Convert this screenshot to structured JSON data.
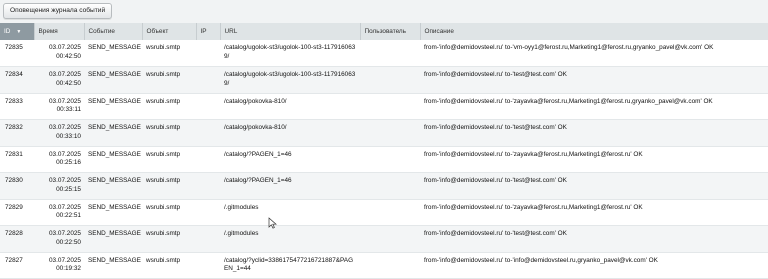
{
  "toolbar": {
    "notify_button": "Оповещения журнала событий"
  },
  "table": {
    "headers": {
      "id": "ID",
      "time": "Время",
      "event": "Событие",
      "object": "Объект",
      "ip": "IP",
      "url": "URL",
      "user": "Пользователь",
      "description": "Описание"
    },
    "sort_icon": "sort-desc-icon",
    "rows": [
      {
        "id": "72835",
        "date": "03.07.2025",
        "time": "00:42:50",
        "event": "SEND_MESSAGE",
        "object": "wsrubi.smtp",
        "ip": "",
        "url": "/catalog/ugolok-st3/ugolok-100-st3-1179160639/",
        "user": "",
        "desc": "from-'info@demidovsteel.ru' to-'vm-oyy1@ferost.ru,Marketing1@ferost.ru,gryanko_pavel@vk.com' OK"
      },
      {
        "id": "72834",
        "date": "03.07.2025",
        "time": "00:42:50",
        "event": "SEND_MESSAGE",
        "object": "wsrubi.smtp",
        "ip": "",
        "url": "/catalog/ugolok-st3/ugolok-100-st3-1179160639/",
        "user": "",
        "desc": "from-'info@demidovsteel.ru' to-'test@test.com' OK"
      },
      {
        "id": "72833",
        "date": "03.07.2025",
        "time": "00:33:11",
        "event": "SEND_MESSAGE",
        "object": "wsrubi.smtp",
        "ip": "",
        "url": "/catalog/pokovka-810/",
        "user": "",
        "desc": "from-'info@demidovsteel.ru' to-'zayavka@ferost.ru,Marketing1@ferost.ru,gryanko_pavel@vk.com' OK"
      },
      {
        "id": "72832",
        "date": "03.07.2025",
        "time": "00:33:10",
        "event": "SEND_MESSAGE",
        "object": "wsrubi.smtp",
        "ip": "",
        "url": "/catalog/pokovka-810/",
        "user": "",
        "desc": "from-'info@demidovsteel.ru' to-'test@test.com' OK"
      },
      {
        "id": "72831",
        "date": "03.07.2025",
        "time": "00:25:16",
        "event": "SEND_MESSAGE",
        "object": "wsrubi.smtp",
        "ip": "",
        "url": "/catalog/?PAGEN_1=46",
        "user": "",
        "desc": "from-'info@demidovsteel.ru' to-'zayavka@ferost.ru,Marketing1@ferost.ru' OK"
      },
      {
        "id": "72830",
        "date": "03.07.2025",
        "time": "00:25:15",
        "event": "SEND_MESSAGE",
        "object": "wsrubi.smtp",
        "ip": "",
        "url": "/catalog/?PAGEN_1=46",
        "user": "",
        "desc": "from-'info@demidovsteel.ru' to-'test@test.com' OK"
      },
      {
        "id": "72829",
        "date": "03.07.2025",
        "time": "00:22:51",
        "event": "SEND_MESSAGE",
        "object": "wsrubi.smtp",
        "ip": "",
        "url": "/.gitmodules",
        "user": "",
        "desc": "from-'info@demidovsteel.ru' to-'zayavka@ferost.ru,Marketing1@ferost.ru' OK"
      },
      {
        "id": "72828",
        "date": "03.07.2025",
        "time": "00:22:50",
        "event": "SEND_MESSAGE",
        "object": "wsrubi.smtp",
        "ip": "",
        "url": "/.gitmodules",
        "user": "",
        "desc": "from-'info@demidovsteel.ru' to-'test@test.com' OK"
      },
      {
        "id": "72827",
        "date": "03.07.2025",
        "time": "00:19:32",
        "event": "SEND_MESSAGE",
        "object": "wsrubi.smtp",
        "ip": "",
        "url": "/catalog/?yclid=3386175477216721887&PAGEN_1=44",
        "user": "",
        "desc": "from-'info@demidovsteel.ru' to-'info@demidovsteel.ru,gryanko_pavel@vk.com' OK"
      }
    ]
  }
}
